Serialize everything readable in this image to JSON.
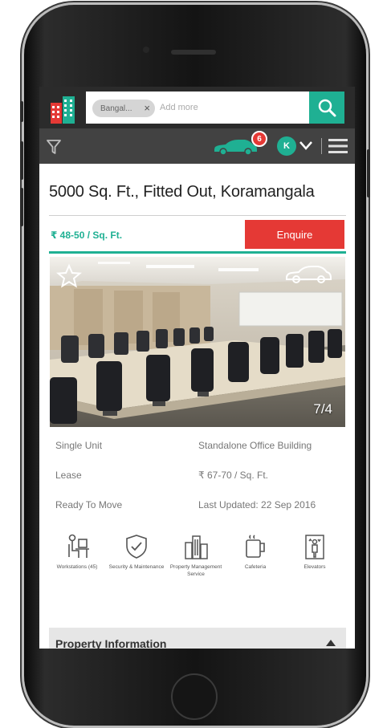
{
  "search": {
    "chip_label": "Bangal...",
    "chip_close": "×",
    "placeholder": "Add more"
  },
  "header": {
    "notification_count": "6",
    "avatar_initial": "K"
  },
  "listing": {
    "title": "5000 Sq. Ft., Fitted Out, Koramangala",
    "price": "₹ 48-50 / Sq. Ft.",
    "enquire_label": "Enquire",
    "photo_counter": "7/4"
  },
  "details": [
    {
      "left": "Single Unit",
      "right": "Standalone Office Building"
    },
    {
      "left": "Lease",
      "right": "₹ 67-70 / Sq. Ft."
    },
    {
      "left": "Ready To Move",
      "right": "Last Updated: 22 Sep 2016"
    }
  ],
  "amenities": [
    {
      "label": "Workstations (45)",
      "icon": "workstation-icon"
    },
    {
      "label": "Security & Maintenance",
      "icon": "shield-check-icon"
    },
    {
      "label": "Property Management Service",
      "icon": "buildings-icon"
    },
    {
      "label": "Cafeteria",
      "icon": "cup-icon"
    },
    {
      "label": "Elevators",
      "icon": "elevator-icon"
    }
  ],
  "section": {
    "property_information": "Property Information"
  },
  "colors": {
    "accent_green": "#1fb093",
    "enquire_red": "#e53935",
    "topbar": "#2b2b2b",
    "subbar": "#424242"
  }
}
